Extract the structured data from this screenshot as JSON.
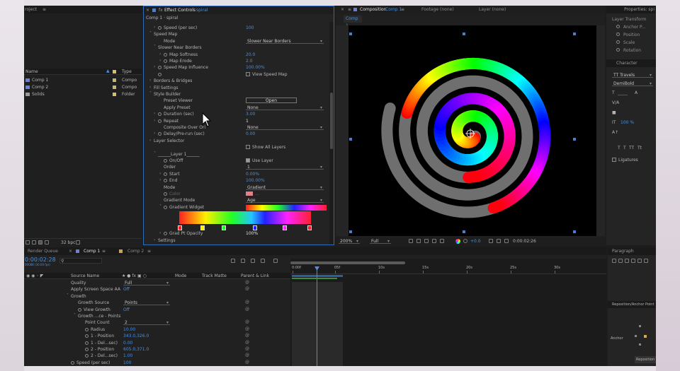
{
  "project": {
    "title": "roject",
    "col_name": "Name",
    "col_type": "Type",
    "bpc": "32 bpc",
    "items": [
      {
        "name": "Comp 1",
        "type": "Compo",
        "kind": "comp"
      },
      {
        "name": "Comp 2",
        "type": "Compo",
        "kind": "comp"
      },
      {
        "name": "Solids",
        "type": "Folder",
        "kind": "folder"
      }
    ]
  },
  "effect_controls": {
    "tab": "Effect Controls",
    "layer": "spiral",
    "path": "Comp 1 · spiral",
    "rows": [
      {
        "label": "Speed (per sec)",
        "value": "100",
        "indent": 1,
        "tw": "closed",
        "sw": true,
        "vc": "blue"
      },
      {
        "label": "Speed Map",
        "indent": 0,
        "tw": "open"
      },
      {
        "label": "Mode",
        "value": "Slower Near Borders",
        "indent": 2,
        "vtype": "dd"
      },
      {
        "label": "Slower Near Borders",
        "indent": 1,
        "tw": "open"
      },
      {
        "label": "Map Softness",
        "value": "20.0",
        "indent": 2,
        "tw": "closed",
        "sw": true,
        "vc": "blue"
      },
      {
        "label": "Map Erode",
        "value": "2.0",
        "indent": 2,
        "tw": "closed",
        "sw": true,
        "vc": "blue"
      },
      {
        "label": "Speed Map Influence",
        "value": "100.00%",
        "indent": 1,
        "tw": "closed",
        "sw": true,
        "vc": "blue"
      },
      {
        "label": "",
        "value": "View Speed Map",
        "indent": 1,
        "sw": true,
        "vtype": "cb"
      },
      {
        "label": "Borders & Bridges",
        "indent": 0,
        "tw": "closed"
      },
      {
        "label": "Fill Settings",
        "indent": 0,
        "tw": "closed"
      },
      {
        "label": "Style Builder",
        "indent": 0,
        "tw": "open"
      },
      {
        "label": "Preset Viewer",
        "value": "Open",
        "indent": 2,
        "vtype": "btn"
      },
      {
        "label": "Apply Preset",
        "value": "None",
        "indent": 2,
        "vtype": "dd"
      },
      {
        "label": "Duration (sec)",
        "value": "3.00",
        "indent": 1,
        "tw": "closed",
        "sw": true,
        "vc": "blue"
      },
      {
        "label": "Repeat",
        "value": "1",
        "indent": 1,
        "tw": "closed",
        "sw": true,
        "vc": "white"
      },
      {
        "label": "Composite Over Ori",
        "value": "None",
        "indent": 2,
        "vtype": "dd"
      },
      {
        "label": "Delay/Pre-run (sec)",
        "value": "0.00",
        "indent": 1,
        "tw": "closed",
        "sw": true,
        "vc": "blue"
      },
      {
        "label": "Layer Selector",
        "indent": 0,
        "tw": "closed"
      },
      {
        "label": "",
        "value": "Show All Layers",
        "indent": 1,
        "vtype": "cb"
      },
      {
        "label": "______Layer 1______",
        "indent": 1,
        "tw": "open"
      },
      {
        "label": "On/Off",
        "value": "Use Layer",
        "indent": 2,
        "sw": true,
        "vtype": "cbon"
      },
      {
        "label": "Order",
        "value": "1",
        "indent": 2,
        "vtype": "dd"
      },
      {
        "label": "Start",
        "value": "0.00%",
        "indent": 2,
        "tw": "closed",
        "sw": true,
        "vc": "blue"
      },
      {
        "label": "End",
        "value": "100.00%",
        "indent": 2,
        "tw": "closed",
        "sw": true,
        "vc": "blue"
      },
      {
        "label": "Mode",
        "value": "Gradient",
        "indent": 2,
        "vtype": "dd"
      },
      {
        "label": "Color",
        "value": "...",
        "indent": 2,
        "sw": true,
        "vtype": "color",
        "dim": true
      },
      {
        "label": "Gradient Mode",
        "value": "Age",
        "indent": 2,
        "vtype": "dd"
      },
      {
        "label": "Gradient Widget",
        "indent": 2,
        "tw": "open",
        "sw": true,
        "vtype": "grad"
      },
      {
        "label": "Grad Pt Opacity",
        "value": "100%",
        "indent": 2,
        "tw": "closed",
        "sw": true,
        "vc": "white"
      },
      {
        "label": "Settings",
        "indent": 1,
        "tw": "closed"
      }
    ]
  },
  "composition": {
    "tab": "Composition",
    "comp_name": "Comp 1",
    "footage": "Footage (none)",
    "layer_tab": "Layer (none)",
    "sub_tab": "Comp 1",
    "zoom": "200%",
    "quality": "Full",
    "exposure": "+0.0",
    "timecode": "0:00:02:26"
  },
  "right_panels": {
    "properties_title": "Properties: spi",
    "layer_transform": "Layer Transform",
    "transform_items": [
      "Anchor P...",
      "Position",
      "Scale",
      "Rotation"
    ],
    "character_title": "Character",
    "font": "TT Travels",
    "style": "DemiBold",
    "tracking_val": "100 %",
    "ligatures": "Ligatures",
    "paragraph_title": "Paragraph",
    "panel2_title": "Reposition/Anchor Point",
    "anchor_label": "Anchor",
    "reposition": "Reposition"
  },
  "timeline": {
    "render_queue": "Render Queue",
    "tab1": "Comp 1",
    "tab2": "Comp 2",
    "timecode": "0:00:02:28",
    "fps": "00088 (30.00 fps)",
    "col_source": "Source Name",
    "col_mode": "Mode",
    "col_track": "Track Matte",
    "col_parent": "Parent & Link",
    "rows": [
      {
        "label": "Quality",
        "value": "Full",
        "indent": 0,
        "vtype": "dd"
      },
      {
        "label": "Apply Screen Space AA",
        "value": "Off",
        "indent": 0,
        "vc": "blue"
      },
      {
        "label": "Growth",
        "indent": 0,
        "tw": "open"
      },
      {
        "label": "Growth Source",
        "value": "Points",
        "indent": 1,
        "vtype": "dd"
      },
      {
        "label": "View Growth",
        "value": "Off",
        "indent": 1,
        "sw": true,
        "vc": "blue"
      },
      {
        "label": "Growth ...ce - Points",
        "indent": 1,
        "tw": "open"
      },
      {
        "label": "Point Count",
        "value": "2",
        "indent": 2,
        "vtype": "dd"
      },
      {
        "label": "Radius",
        "value": "10.00",
        "indent": 2,
        "sw": true,
        "vc": "blue"
      },
      {
        "label": "1 - Position",
        "value": "343.0,326.0",
        "indent": 2,
        "sw": true,
        "vc": "blue"
      },
      {
        "label": "1 - Del...sec)",
        "value": "0.00",
        "indent": 2,
        "sw": true,
        "vc": "blue"
      },
      {
        "label": "2 - Position",
        "value": "605.0,371.0",
        "indent": 2,
        "sw": true,
        "vc": "blue"
      },
      {
        "label": "2 - Del...sec)",
        "value": "1.00",
        "indent": 2,
        "sw": true,
        "vc": "blue"
      },
      {
        "label": "Speed (per sec)",
        "value": "100",
        "indent": 0,
        "sw": true,
        "vc": "blue"
      }
    ],
    "ruler": [
      "0:00f",
      "05f",
      "10s",
      "15s",
      "20s",
      "25s",
      "30s"
    ]
  },
  "colors": {
    "accent": "#4a90e0",
    "panel": "#232323",
    "viewer": "#000000",
    "ring": "#6f6f6f",
    "selection": "#2d5f9a"
  }
}
